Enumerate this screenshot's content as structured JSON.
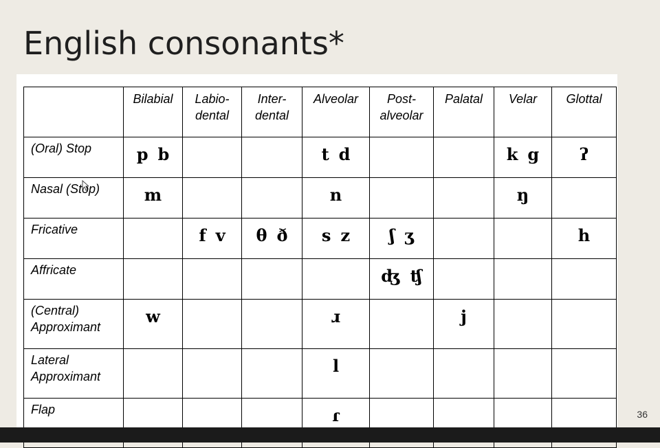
{
  "slide": {
    "title": "English consonants*",
    "page_number": "36"
  },
  "table": {
    "columns": [
      "",
      "Bilabial",
      "Labio-\ndental",
      "Inter-\ndental",
      "Alveolar",
      "Post-\nalveolar",
      "Palatal",
      "Velar",
      "Glottal"
    ],
    "rows": [
      {
        "label": "(Oral) Stop",
        "cells": [
          [
            "p",
            "b"
          ],
          [],
          [],
          [
            "t",
            "d"
          ],
          [],
          [],
          [
            "k",
            "g"
          ],
          [
            "ʔ"
          ]
        ]
      },
      {
        "label": "Nasal (Stop)",
        "cells": [
          [
            "m"
          ],
          [],
          [],
          [
            "n"
          ],
          [],
          [],
          [
            "ŋ"
          ],
          []
        ]
      },
      {
        "label": "Fricative",
        "cells": [
          [],
          [
            "f",
            "v"
          ],
          [
            "θ",
            "ð"
          ],
          [
            "s",
            "z"
          ],
          [
            "ʃ",
            "ʒ"
          ],
          [],
          [],
          [
            "h"
          ]
        ]
      },
      {
        "label": "Affricate",
        "cells": [
          [],
          [],
          [],
          [],
          [
            "ʤ",
            "ʧ"
          ],
          [],
          [],
          []
        ]
      },
      {
        "label": "(Central)\nApproximant",
        "cells": [
          [
            "w"
          ],
          [],
          [],
          [
            "ɹ"
          ],
          [],
          [
            "j"
          ],
          [],
          []
        ]
      },
      {
        "label": "Lateral\nApproximant",
        "cells": [
          [],
          [],
          [],
          [
            "l"
          ],
          [],
          [],
          [],
          []
        ]
      },
      {
        "label": "Flap",
        "cells": [
          [],
          [],
          [],
          [
            "ɾ"
          ],
          [],
          [],
          [],
          []
        ]
      }
    ]
  }
}
